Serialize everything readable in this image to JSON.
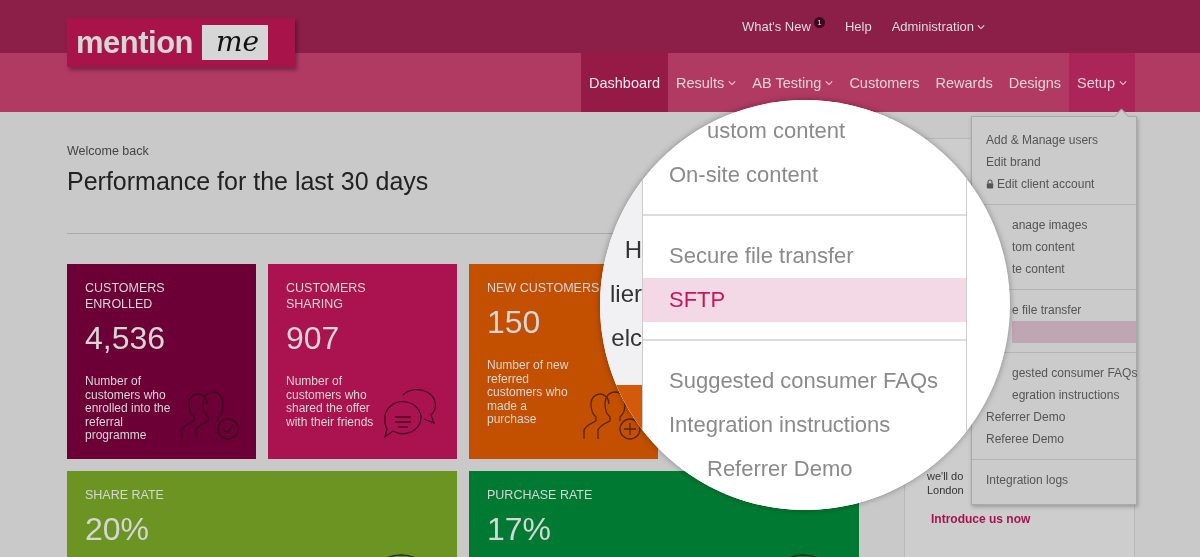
{
  "logo": {
    "word": "mention",
    "script": "me"
  },
  "top_links": [
    {
      "label": "What's New",
      "badge": "1",
      "caret": false
    },
    {
      "label": "Help",
      "caret": false
    },
    {
      "label": "Administration",
      "caret": true
    }
  ],
  "nav": [
    {
      "label": "Dashboard",
      "caret": false,
      "selected": true,
      "open": false
    },
    {
      "label": "Results",
      "caret": true,
      "selected": false,
      "open": false
    },
    {
      "label": "AB Testing",
      "caret": true,
      "selected": false,
      "open": false
    },
    {
      "label": "Customers",
      "caret": false,
      "selected": false,
      "open": false
    },
    {
      "label": "Rewards",
      "caret": false,
      "selected": false,
      "open": false
    },
    {
      "label": "Designs",
      "caret": false,
      "selected": false,
      "open": false
    },
    {
      "label": "Setup",
      "caret": true,
      "selected": false,
      "open": true
    }
  ],
  "welcome": "Welcome back",
  "heading": "Performance for the last 30 days",
  "cards": [
    {
      "title": "CUSTOMERS ENROLLED",
      "value": "4,536",
      "description": "Number of customers who enrolled into the referral programme",
      "color": "#6c0036"
    },
    {
      "title": "CUSTOMERS SHARING",
      "value": "907",
      "description": "Number of customers who shared the offer with their friends",
      "color": "#ab1350"
    },
    {
      "title": "NEW CUSTOMERS",
      "value": "150",
      "description": "Number of new referred customers who made a purchase",
      "color": "#c35000"
    }
  ],
  "rate_cards": [
    {
      "title": "SHARE RATE",
      "value": "20%",
      "color": "#6b9423"
    },
    {
      "title": "PURCHASE RATE",
      "value": "17%",
      "color": "#007a32"
    }
  ],
  "side_panel": {
    "lines": [
      "we'll do",
      "London"
    ],
    "link": "Introduce us now"
  },
  "setup_menu": {
    "groups": [
      [
        {
          "label": "Add & Manage users",
          "kind": "full",
          "selected": false
        },
        {
          "label": "Edit brand",
          "kind": "full",
          "selected": false
        },
        {
          "label": "Edit client account",
          "kind": "locked",
          "selected": false
        }
      ],
      [
        {
          "label": "anage images",
          "kind": "cut",
          "selected": false
        },
        {
          "label": "tom content",
          "kind": "cut",
          "selected": false
        },
        {
          "label": "te content",
          "kind": "cut",
          "selected": false
        }
      ],
      [
        {
          "label": "e file transfer",
          "kind": "cut",
          "selected": false
        },
        {
          "kind": "cut",
          "selected": true
        }
      ],
      [
        {
          "label": "gested consumer FAQs",
          "kind": "cut",
          "selected": false
        },
        {
          "label": "egration instructions",
          "kind": "cut",
          "selected": false
        },
        {
          "label": "Referrer Demo",
          "kind": "full",
          "selected": false
        },
        {
          "label": "Referee Demo",
          "kind": "full",
          "selected": false
        }
      ],
      [
        {
          "label": "Integration logs",
          "kind": "full",
          "selected": false
        }
      ]
    ]
  },
  "magnifier": {
    "fragments": [
      "H",
      "lier",
      "elc"
    ],
    "groups": [
      [
        {
          "label": "ustom content",
          "kind": "cut",
          "selected": false
        },
        {
          "label": "On-site content",
          "kind": "full",
          "selected": false
        }
      ],
      [
        {
          "label": "Secure file transfer",
          "kind": "full",
          "selected": false
        },
        {
          "label": "SFTP",
          "kind": "full",
          "selected": true
        }
      ],
      [
        {
          "label": "Suggested consumer FAQs",
          "kind": "full",
          "selected": false
        },
        {
          "label": "Integration instructions",
          "kind": "full",
          "selected": false
        },
        {
          "label": "Referrer Demo",
          "kind": "cut",
          "selected": false
        }
      ]
    ]
  }
}
